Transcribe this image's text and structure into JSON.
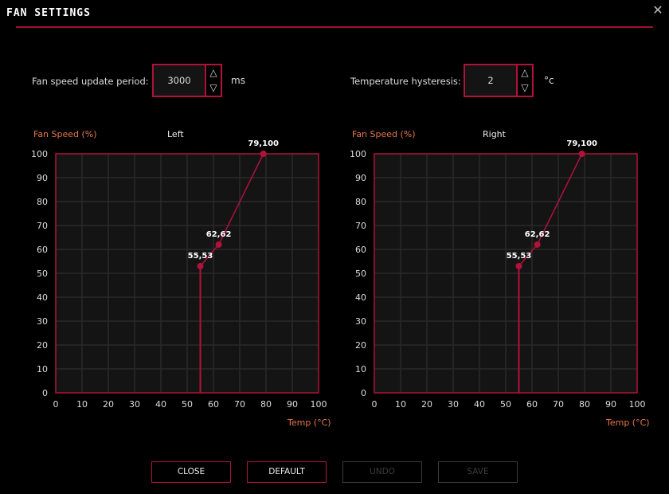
{
  "window": {
    "title": "FAN SETTINGS",
    "close_icon": "close-x-icon"
  },
  "settings": {
    "update_period": {
      "label": "Fan speed update period:",
      "value": "3000",
      "unit": "ms",
      "up_glyph": "△",
      "down_glyph": "▽"
    },
    "hysteresis": {
      "label": "Temperature hysteresis:",
      "value": "2",
      "unit": "°c",
      "up_glyph": "△",
      "down_glyph": "▽"
    }
  },
  "colors": {
    "accent": "#b0123a",
    "axis_title": "#e5784a",
    "plot_bg": "#141414",
    "grid": "#2a2a2a"
  },
  "chart_data": [
    {
      "type": "line",
      "name": "Left",
      "ylabel": "Fan Speed (%)",
      "xlabel": "Temp (°C)",
      "xlim": [
        0,
        100
      ],
      "ylim": [
        0,
        100
      ],
      "xticks": [
        "0",
        "10",
        "20",
        "30",
        "40",
        "50",
        "60",
        "70",
        "80",
        "90",
        "100"
      ],
      "yticks": [
        "0",
        "10",
        "20",
        "30",
        "40",
        "50",
        "60",
        "70",
        "80",
        "90",
        "100"
      ],
      "grid": true,
      "baseline_x": 55,
      "points": [
        {
          "x": 55,
          "y": 53,
          "label": "55,53"
        },
        {
          "x": 62,
          "y": 62,
          "label": "62,62"
        },
        {
          "x": 79,
          "y": 100,
          "label": "79,100"
        }
      ]
    },
    {
      "type": "line",
      "name": "Right",
      "ylabel": "Fan Speed (%)",
      "xlabel": "Temp (°C)",
      "xlim": [
        0,
        100
      ],
      "ylim": [
        0,
        100
      ],
      "xticks": [
        "0",
        "10",
        "20",
        "30",
        "40",
        "50",
        "60",
        "70",
        "80",
        "90",
        "100"
      ],
      "yticks": [
        "0",
        "10",
        "20",
        "30",
        "40",
        "50",
        "60",
        "70",
        "80",
        "90",
        "100"
      ],
      "grid": true,
      "baseline_x": 55,
      "points": [
        {
          "x": 55,
          "y": 53,
          "label": "55,53"
        },
        {
          "x": 62,
          "y": 62,
          "label": "62,62"
        },
        {
          "x": 79,
          "y": 100,
          "label": "79,100"
        }
      ]
    }
  ],
  "buttons": {
    "close": "CLOSE",
    "default": "DEFAULT",
    "undo": "UNDO",
    "save": "SAVE"
  }
}
